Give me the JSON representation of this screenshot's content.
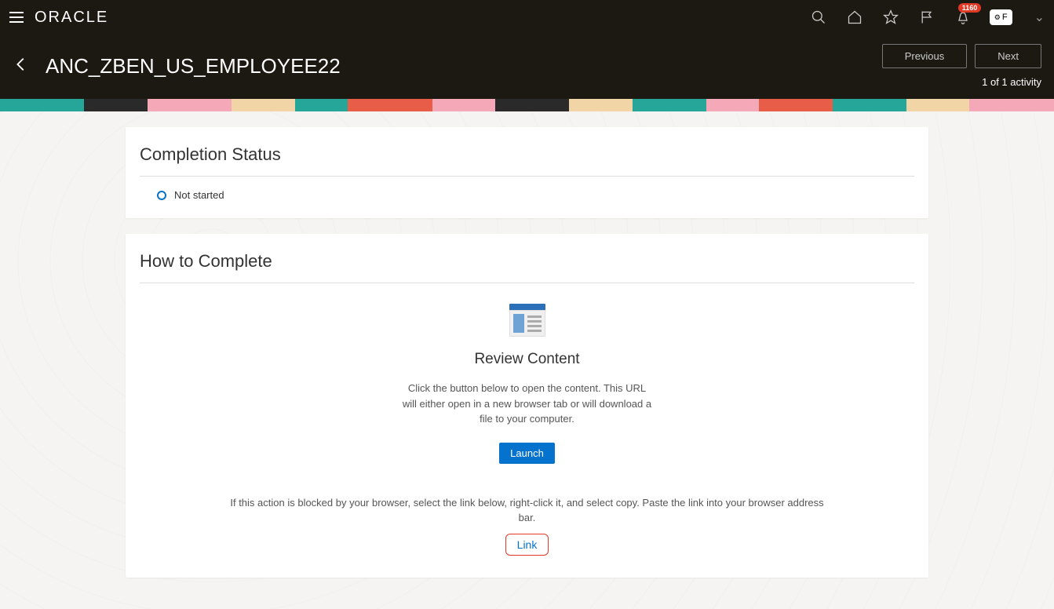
{
  "topbar": {
    "brand": "ORACLE",
    "notification_count": "1160",
    "user_initial": "F"
  },
  "header": {
    "page_title": "ANC_ZBEN_US_EMPLOYEE22",
    "previous_label": "Previous",
    "next_label": "Next",
    "activity_count": "1 of 1 activity"
  },
  "completion": {
    "title": "Completion Status",
    "status_text": "Not started"
  },
  "howto": {
    "title": "How to Complete",
    "review_heading": "Review Content",
    "review_text": "Click the button below to open the content. This URL will either open in a new browser tab or will download a file to your computer.",
    "launch_label": "Launch",
    "blocked_text": "If this action is blocked by your browser, select the link below, right-click it, and select copy. Paste the link into your browser address bar.",
    "link_label": "Link"
  }
}
